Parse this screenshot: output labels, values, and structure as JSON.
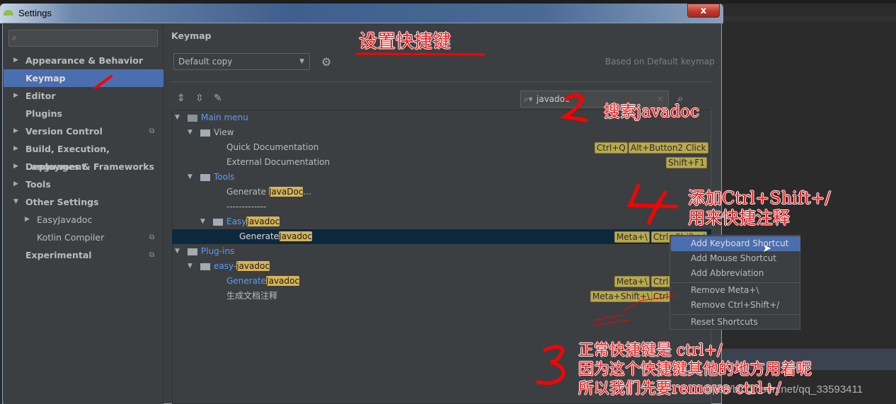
{
  "window": {
    "title": "Settings",
    "close": "x"
  },
  "sidebar": {
    "search_placeholder": "",
    "items": [
      {
        "label": "Appearance & Behavior",
        "arrow": "▶"
      },
      {
        "label": "Keymap",
        "arrow": ""
      },
      {
        "label": "Editor",
        "arrow": "▶"
      },
      {
        "label": "Plugins",
        "arrow": ""
      },
      {
        "label": "Version Control",
        "arrow": "▶",
        "project": "⧉"
      },
      {
        "label": "Build, Execution, Deployment",
        "arrow": "▶"
      },
      {
        "label": "Languages & Frameworks",
        "arrow": "▶"
      },
      {
        "label": "Tools",
        "arrow": "▶"
      },
      {
        "label": "Other Settings",
        "arrow": "▼"
      },
      {
        "label": "EasyJavadoc",
        "arrow": "▶"
      },
      {
        "label": "Kotlin Compiler",
        "arrow": "",
        "project": "⧉"
      },
      {
        "label": "Experimental",
        "arrow": "",
        "project": "⧉"
      }
    ]
  },
  "keymap": {
    "title": "Keymap",
    "selected": "Default copy",
    "based_on": "Based on Default keymap",
    "search_value": "javadoc",
    "tree": {
      "main_menu": "Main menu",
      "view": "View",
      "quick_doc": "Quick Documentation",
      "external_doc": "External Documentation",
      "tools": "Tools",
      "gen_javadoc_pre": "Generate ",
      "gen_javadoc_hl": "JavaDoc",
      "gen_javadoc_post": "...",
      "separator": "-------------",
      "easy_pre": "Easy",
      "easy_hl": "Javadoc",
      "gen_pre": "Generate",
      "gen_hl": "Javadoc",
      "plugins": "Plug-ins",
      "easyjd_pre": "easy-",
      "easyjd_hl": "javadoc",
      "pgen_pre": "Generate",
      "pgen_hl": "Javadoc",
      "cn_item": "生成文档注释"
    },
    "shortcuts": {
      "quick": [
        "Ctrl+Q",
        "Alt+Button2 Click"
      ],
      "external": [
        "Shift+F1"
      ],
      "gen_selected": [
        "Meta+\\",
        "Ctrl+Shift+/"
      ],
      "plugin_gen": [
        "Meta+\\",
        "Ctrl+"
      ],
      "plugin_cn": [
        "Meta+Shift+\\",
        "Ctrl+"
      ]
    }
  },
  "context_menu": {
    "items": [
      "Add Keyboard Shortcut",
      "Add Mouse Shortcut",
      "Add Abbreviation",
      "Remove Meta+\\",
      "Remove Ctrl+Shift+/",
      "Reset Shortcuts"
    ],
    "active": "Add Keyboard Shortcut"
  },
  "annotations": {
    "a1": "设置快捷键",
    "a2": "搜索javadoc",
    "a4_l1": "添加Ctrl+Shift+/",
    "a4_l2": "用来快捷注释",
    "a3_l1": "正常快捷键是 ctrl+/",
    "a3_l2": "因为这个快捷键其他的地方用着呢",
    "a3_l3": "所以我们先要remove ctrl+/"
  },
  "watermark": "https://blog.csdn.net/qq_33593411",
  "colors": {
    "accent": "#4b6eaf",
    "selection": "#0d293e",
    "highlight": "#d6b457",
    "annotation": "#ff1a1a",
    "link": "#589df6"
  }
}
